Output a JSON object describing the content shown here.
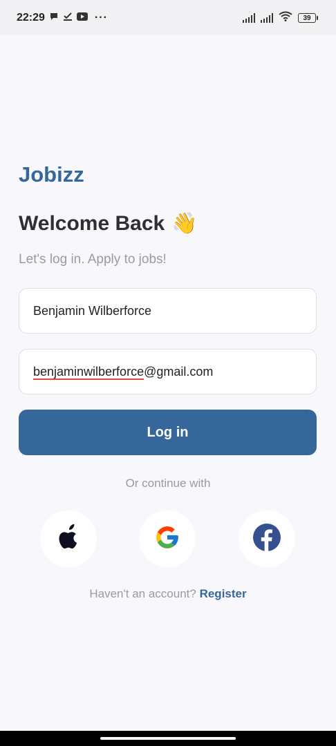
{
  "status_bar": {
    "time": "22:29",
    "more": "···",
    "battery": "39",
    "icons": [
      "chat-icon",
      "check-download-icon",
      "youtube-icon",
      "signal-icon",
      "signal-icon",
      "wifi-icon",
      "battery-icon"
    ]
  },
  "brand": "Jobizz",
  "title": "Welcome Back",
  "title_emoji": "👋",
  "subtitle": "Let's log in. Apply to jobs!",
  "form": {
    "name_value": "Benjamin Wilberforce",
    "email_user": "benjaminwilberforce",
    "email_domain": "@gmail.com"
  },
  "login_label": "Log in",
  "divider_text": "Or continue with",
  "social": [
    {
      "name": "apple",
      "icon": "apple-icon"
    },
    {
      "name": "google",
      "icon": "google-icon"
    },
    {
      "name": "facebook",
      "icon": "facebook-icon"
    }
  ],
  "register": {
    "prompt": "Haven't an account?",
    "link": "Register"
  },
  "colors": {
    "brand": "#35679a",
    "primary_button": "#36679a",
    "background": "#f8f7fb",
    "muted_text": "#9a9aa0"
  }
}
